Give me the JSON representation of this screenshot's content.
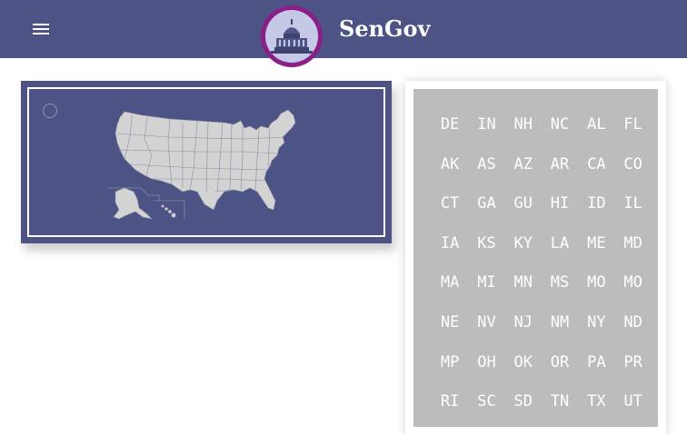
{
  "header": {
    "title": "SenGov",
    "menu_icon": "menu-icon",
    "logo_icon": "capitol-icon",
    "background": "#4d5384"
  },
  "map": {
    "radio": "circle-icon",
    "map_icon": "us-map-icon"
  },
  "states": {
    "codes": [
      "DE",
      "IN",
      "NH",
      "NC",
      "AL",
      "FL",
      "AK",
      "AS",
      "AZ",
      "AR",
      "CA",
      "CO",
      "CT",
      "GA",
      "GU",
      "HI",
      "ID",
      "IL",
      "IA",
      "KS",
      "KY",
      "LA",
      "ME",
      "MD",
      "MA",
      "MI",
      "MN",
      "MS",
      "MO",
      "MO",
      "NE",
      "NV",
      "NJ",
      "NM",
      "NY",
      "ND",
      "MP",
      "OH",
      "OK",
      "OR",
      "PA",
      "PR",
      "RI",
      "SC",
      "SD",
      "TN",
      "TX",
      "UT"
    ]
  },
  "colors": {
    "accent": "#4d5384",
    "logo_ring": "#8b1f8a",
    "state_panel": "#bcbcbc"
  }
}
